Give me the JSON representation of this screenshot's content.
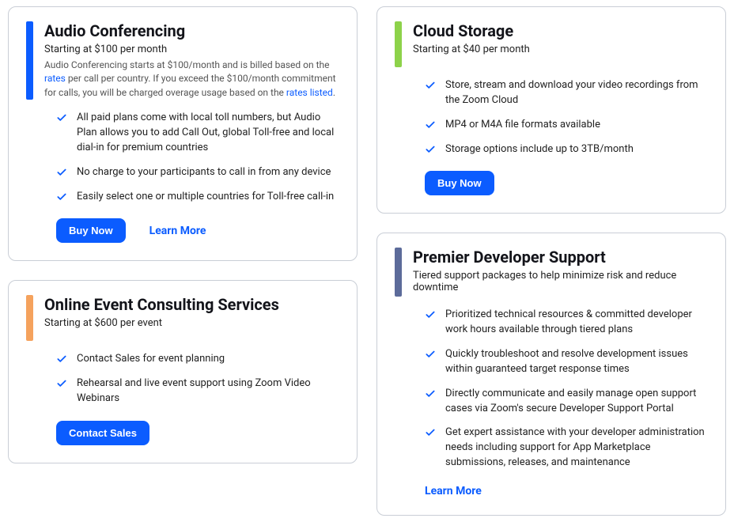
{
  "cards": {
    "audio": {
      "title": "Audio Conferencing",
      "subtitle": "Starting at $100 per month",
      "desc_part1": "Audio Conferencing starts at $100/month and is billed based on the ",
      "desc_link1": "rates",
      "desc_part2": " per call per country. If you exceed the $100/month commitment for calls, you will be charged overage usage based on the ",
      "desc_link2": "rates listed",
      "desc_part3": ".",
      "features": [
        "All paid plans come with local toll numbers, but Audio Plan allows you to add Call Out, global Toll-free and local dial-in for premium countries",
        "No charge to your participants to call in from any device",
        "Easily select one or multiple countries for Toll-free call-in"
      ],
      "buy_label": "Buy Now",
      "learn_label": "Learn More"
    },
    "cloud": {
      "title": "Cloud Storage",
      "subtitle": "Starting at $40 per month",
      "features": [
        "Store, stream and download your video recordings from the Zoom Cloud",
        "MP4 or M4A file formats available",
        "Storage options include up to 3TB/month"
      ],
      "buy_label": "Buy Now"
    },
    "consulting": {
      "title": "Online Event Consulting Services",
      "subtitle": "Starting at $600 per event",
      "features": [
        "Contact Sales for event planning",
        "Rehearsal and live event support using Zoom Video Webinars"
      ],
      "button_label": "Contact Sales"
    },
    "devsupport": {
      "title": "Premier Developer Support",
      "subtitle": "Tiered support packages to help minimize risk and reduce downtime",
      "features": [
        "Prioritized technical resources & committed developer work hours available through tiered plans",
        "Quickly troubleshoot and resolve development issues within guaranteed target response times",
        "Directly communicate and easily manage open support cases via Zoom's secure Developer Support Portal",
        "Get expert assistance with your developer administration needs including support for App Marketplace submissions, releases, and maintenance"
      ],
      "learn_label": "Learn More"
    }
  }
}
